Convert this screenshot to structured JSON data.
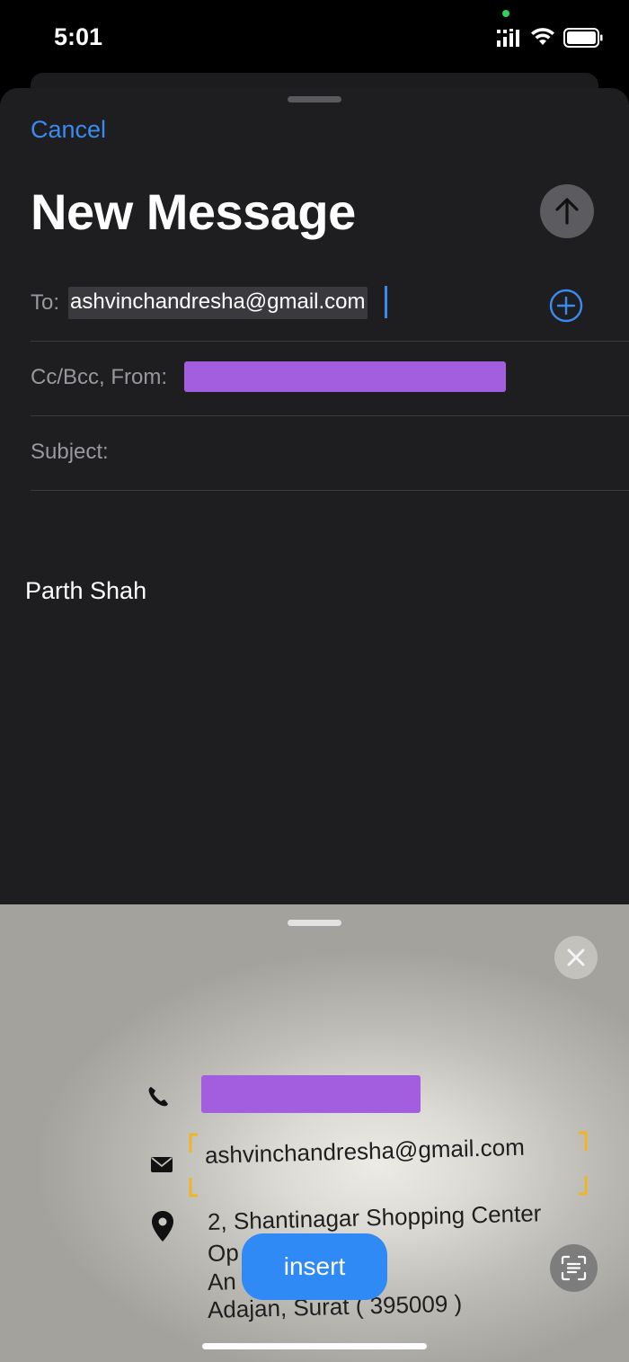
{
  "status_bar": {
    "time": "5:01"
  },
  "compose": {
    "cancel_label": "Cancel",
    "title": "New Message",
    "to_label": "To:",
    "to_value": "ashvinchandresha@gmail.com",
    "cc_label": "Cc/Bcc, From:",
    "subject_label": "Subject:",
    "body_signature": "Parth Shah"
  },
  "live_text": {
    "card_email": "ashvinchandresha@gmail.com",
    "address_lines": [
      "2, Shantinagar Shopping Center",
      "Op                      ade,",
      "An                      oad,",
      "Adajan, Surat ( 395009 )"
    ],
    "insert_label": "insert"
  },
  "colors": {
    "accent": "#3a8bf0",
    "insert_button": "#2f8af5",
    "redaction": "#a35ee0",
    "sheet_background": "#1e1e20"
  },
  "icons": [
    "arrow-up-icon",
    "plus-circle-icon",
    "close-icon",
    "phone-icon",
    "mail-icon",
    "location-pin-icon",
    "text-scan-icon",
    "wifi-icon",
    "battery-icon",
    "signal-icon"
  ]
}
